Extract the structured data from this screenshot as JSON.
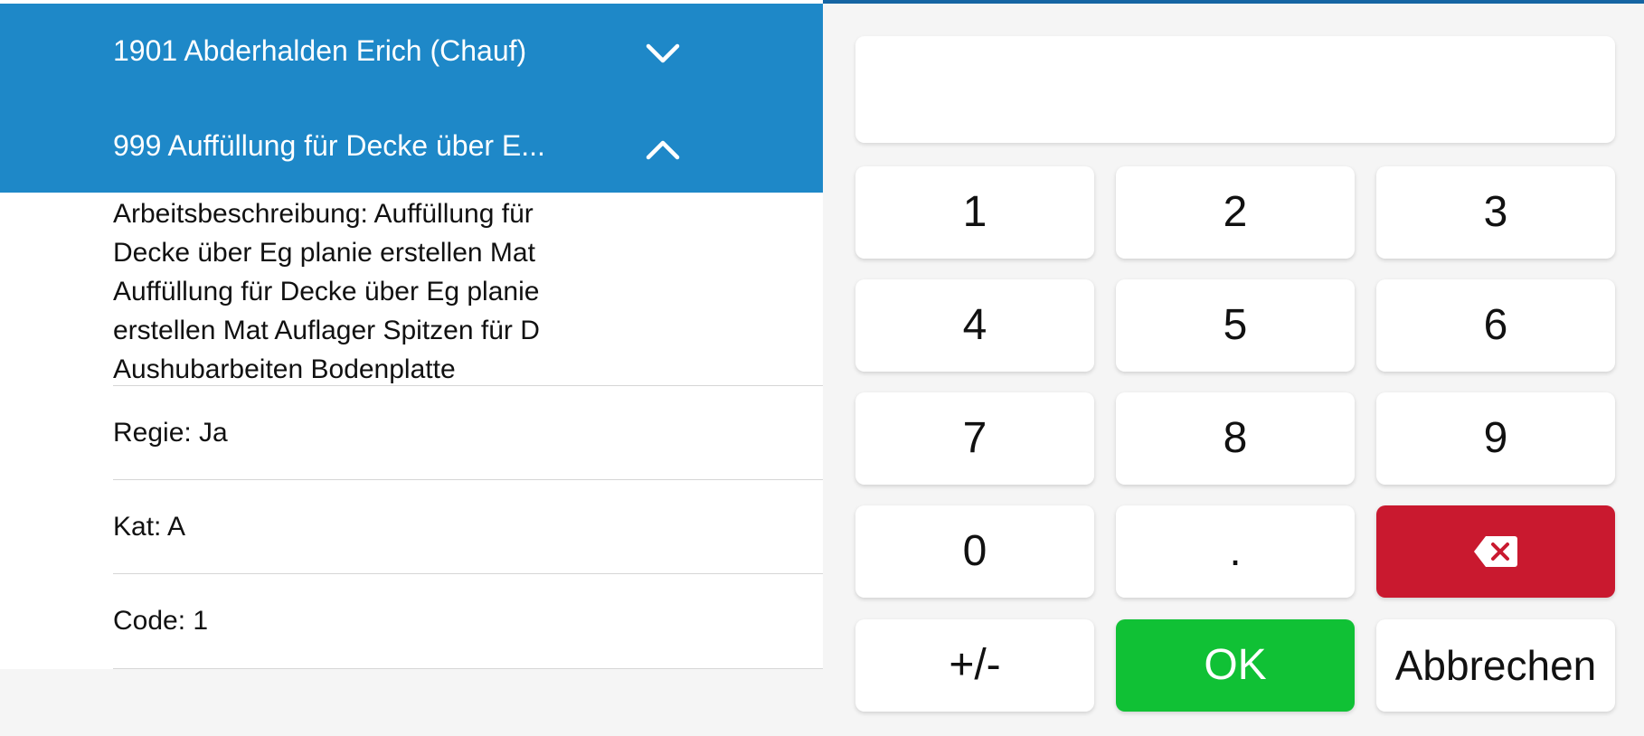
{
  "accordion": {
    "employee_label": "1901 Abderhalden Erich (Chauf)",
    "task_label": "999 Auffüllung für Decke über E...",
    "colors": {
      "header_bg": "#1e88c8",
      "header_text": "#ffffff"
    }
  },
  "details": {
    "description_lines": [
      "Arbeitsbeschreibung: Auffüllung für",
      "Decke über Eg planie erstellen Mat",
      "Auffüllung für Decke über Eg planie",
      "erstellen Mat Auflager Spitzen für D",
      "Aushubarbeiten Bodenplatte"
    ],
    "regie": "Regie: Ja",
    "kat": "Kat: A",
    "code": "Code: 1"
  },
  "keypad": {
    "display_value": "",
    "keys": {
      "k1": "1",
      "k2": "2",
      "k3": "3",
      "k4": "4",
      "k5": "5",
      "k6": "6",
      "k7": "7",
      "k8": "8",
      "k9": "9",
      "k0": "0",
      "kdot": ".",
      "sign": "+/-",
      "ok": "OK",
      "cancel": "Abbrechen"
    },
    "backspace_icon": "backspace-icon",
    "colors": {
      "ok_bg": "#10c135",
      "backspace_bg": "#c9192f",
      "key_bg": "#ffffff"
    }
  }
}
